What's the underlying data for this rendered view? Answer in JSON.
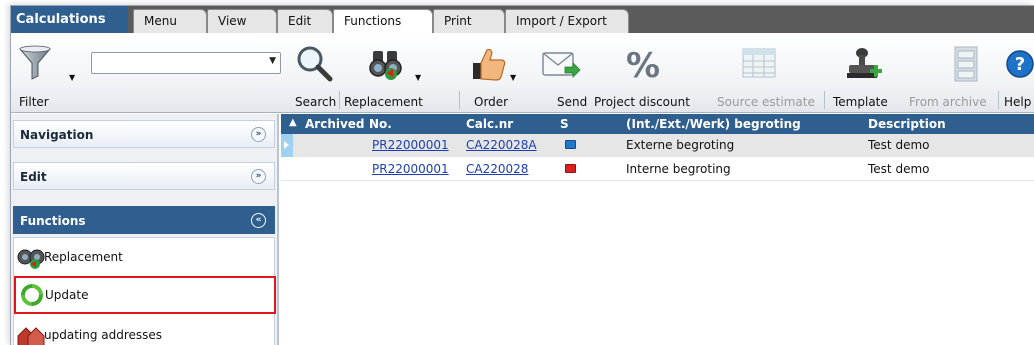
{
  "app": {
    "title": "Calculations"
  },
  "tabs": [
    {
      "label": "Menu",
      "active": false
    },
    {
      "label": "View",
      "active": false
    },
    {
      "label": "Edit",
      "active": false
    },
    {
      "label": "Functions",
      "active": true
    },
    {
      "label": "Print",
      "active": false
    },
    {
      "label": "Import / Export",
      "active": false
    }
  ],
  "ribbon": {
    "filter": {
      "label": "Filter",
      "icon": "funnel-icon",
      "input_value": ""
    },
    "buttons": [
      {
        "label": "Search",
        "icon": "magnifier-icon",
        "enabled": true
      },
      {
        "label": "Replacement",
        "icon": "binoculars-icon",
        "enabled": true
      },
      {
        "label": "Order",
        "icon": "thumbs-up-icon",
        "enabled": true
      },
      {
        "label": "Send",
        "icon": "envelope-icon",
        "enabled": true
      },
      {
        "label": "Project discount",
        "icon": "percent-icon",
        "enabled": true
      },
      {
        "label": "Source estimate",
        "icon": "spreadsheet-icon",
        "enabled": false
      },
      {
        "label": "Template",
        "icon": "stamp-icon",
        "enabled": true
      },
      {
        "label": "From archive",
        "icon": "cabinet-icon",
        "enabled": false
      },
      {
        "label": "Help",
        "icon": "help-icon",
        "enabled": true
      }
    ]
  },
  "sidebar": {
    "panels": [
      {
        "title": "Navigation",
        "expanded": false
      },
      {
        "title": "Edit",
        "expanded": false
      },
      {
        "title": "Functions",
        "expanded": true
      }
    ],
    "items": [
      {
        "label": "Replacement",
        "icon": "binoculars-icon",
        "selected": false
      },
      {
        "label": "Update",
        "icon": "refresh-icon",
        "selected": true
      },
      {
        "label": "updating addresses",
        "icon": "addresses-icon",
        "selected": false
      }
    ]
  },
  "grid": {
    "columns": [
      "Archived",
      "No.",
      "Calc.nr",
      "S",
      "(Int./Ext./Werk) begroting",
      "Description"
    ],
    "sort_indicator": "▲",
    "rows": [
      {
        "archived": "",
        "no": "PR22000001",
        "calc_nr": "CA220028A",
        "status_color": "#1f78c8",
        "begroting": "Externe begroting",
        "description": "Test demo",
        "selected": true
      },
      {
        "archived": "",
        "no": "PR22000001",
        "calc_nr": "CA220028",
        "status_color": "#d9201f",
        "begroting": "Interne begroting",
        "description": "Test demo",
        "selected": false
      }
    ]
  },
  "colors": {
    "header_blue": "#2e5f8f",
    "highlight_red": "#e0161b",
    "link_blue": "#1c3fb4"
  }
}
